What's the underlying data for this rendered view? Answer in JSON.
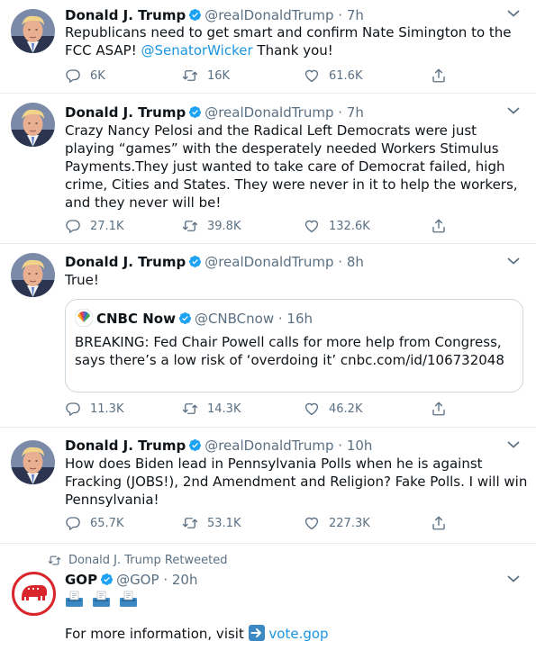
{
  "tweets": [
    {
      "name": "Donald J. Trump",
      "handle": "@realDonaldTrump",
      "time": "· 7h",
      "text_before": "Republicans need to get smart and confirm Nate Simington to the FCC ASAP! ",
      "mention": "@SenatorWicker",
      "text_after": " Thank you!",
      "replies": "6K",
      "retweets": "16K",
      "likes": "61.6K"
    },
    {
      "name": "Donald J. Trump",
      "handle": "@realDonaldTrump",
      "time": "· 7h",
      "text": "Crazy Nancy Pelosi and the Radical Left Democrats were just playing “games” with the desperately needed Workers Stimulus Payments.They just wanted to take care of Democrat failed, high crime, Cities and States. They were never in it to help the workers, and they never will be!",
      "replies": "27.1K",
      "retweets": "39.8K",
      "likes": "132.6K"
    },
    {
      "name": "Donald J. Trump",
      "handle": "@realDonaldTrump",
      "time": "· 8h",
      "text": "True!",
      "quote": {
        "name": "CNBC Now",
        "handle": "@CNBCnow",
        "time": "· 16h",
        "text": "BREAKING: Fed Chair Powell calls for more help from Congress, says there’s a low risk of ‘overdoing it’ cnbc.com/id/106732048"
      },
      "replies": "11.3K",
      "retweets": "14.3K",
      "likes": "46.2K"
    },
    {
      "name": "Donald J. Trump",
      "handle": "@realDonaldTrump",
      "time": "· 10h",
      "text": "How does Biden lead in Pennsylvania Polls when he is against Fracking (JOBS!), 2nd Amendment and Religion? Fake Polls. I will win Pennsylvania!",
      "replies": "65.7K",
      "retweets": "53.1K",
      "likes": "227.3K"
    },
    {
      "retweeted_by": "Donald J. Trump Retweeted",
      "name": "GOP",
      "handle": "@GOP",
      "time": "· 20h",
      "text_before": "For more information, visit ",
      "link": "vote.gop"
    }
  ],
  "icons": {
    "reply": "reply-icon",
    "retweet": "retweet-icon",
    "like": "heart-icon",
    "share": "share-icon",
    "verified": "verified-badge-icon",
    "more": "chevron-down-icon",
    "ballot": "ballot-box-icon",
    "arrow": "right-arrow-icon"
  },
  "colors": {
    "link": "#1b95e0",
    "secondary": "#5b7083",
    "verified": "#1da1f2",
    "gop_red": "#d9262c"
  }
}
